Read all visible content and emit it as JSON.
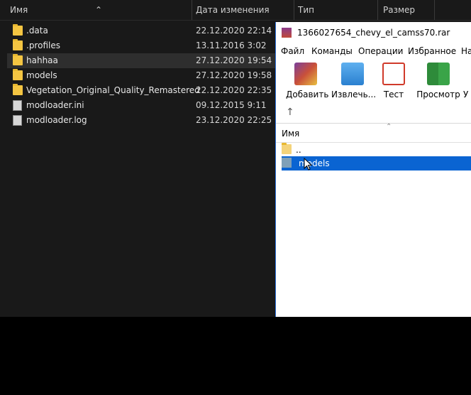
{
  "explorer": {
    "columns": {
      "name": "Имя",
      "date": "Дата изменения",
      "type": "Тип",
      "size": "Размер"
    },
    "files": [
      {
        "name": ".data",
        "date": "22.12.2020 22:14",
        "kind": "folder"
      },
      {
        "name": ".profiles",
        "date": "13.11.2016 3:02",
        "kind": "folder"
      },
      {
        "name": "hahhaa",
        "date": "27.12.2020 19:54",
        "kind": "folder"
      },
      {
        "name": "models",
        "date": "27.12.2020 19:58",
        "kind": "folder"
      },
      {
        "name": "Vegetation_Original_Quality_Remastered",
        "date": "22.12.2020 22:35",
        "kind": "folder"
      },
      {
        "name": "modloader.ini",
        "date": "09.12.2015 9:11",
        "kind": "ini-file"
      },
      {
        "name": "modloader.log",
        "date": "23.12.2020 22:25",
        "kind": "log-file"
      }
    ]
  },
  "rar": {
    "title": "1366027654_chevy_el_camss70.rar",
    "menu": [
      "Файл",
      "Команды",
      "Операции",
      "Избранное",
      "На"
    ],
    "toolbar": [
      "Добавить",
      "Извлечь...",
      "Тест",
      "Просмотр",
      "У"
    ],
    "list_header": "Имя",
    "items": [
      {
        "name": "..",
        "kind": "folder"
      },
      {
        "name": "models",
        "kind": "folder",
        "selected": true
      }
    ]
  },
  "colors": {
    "explorer_bg": "#191919",
    "selection": "#0a64d2",
    "folder": "#f4c542"
  }
}
